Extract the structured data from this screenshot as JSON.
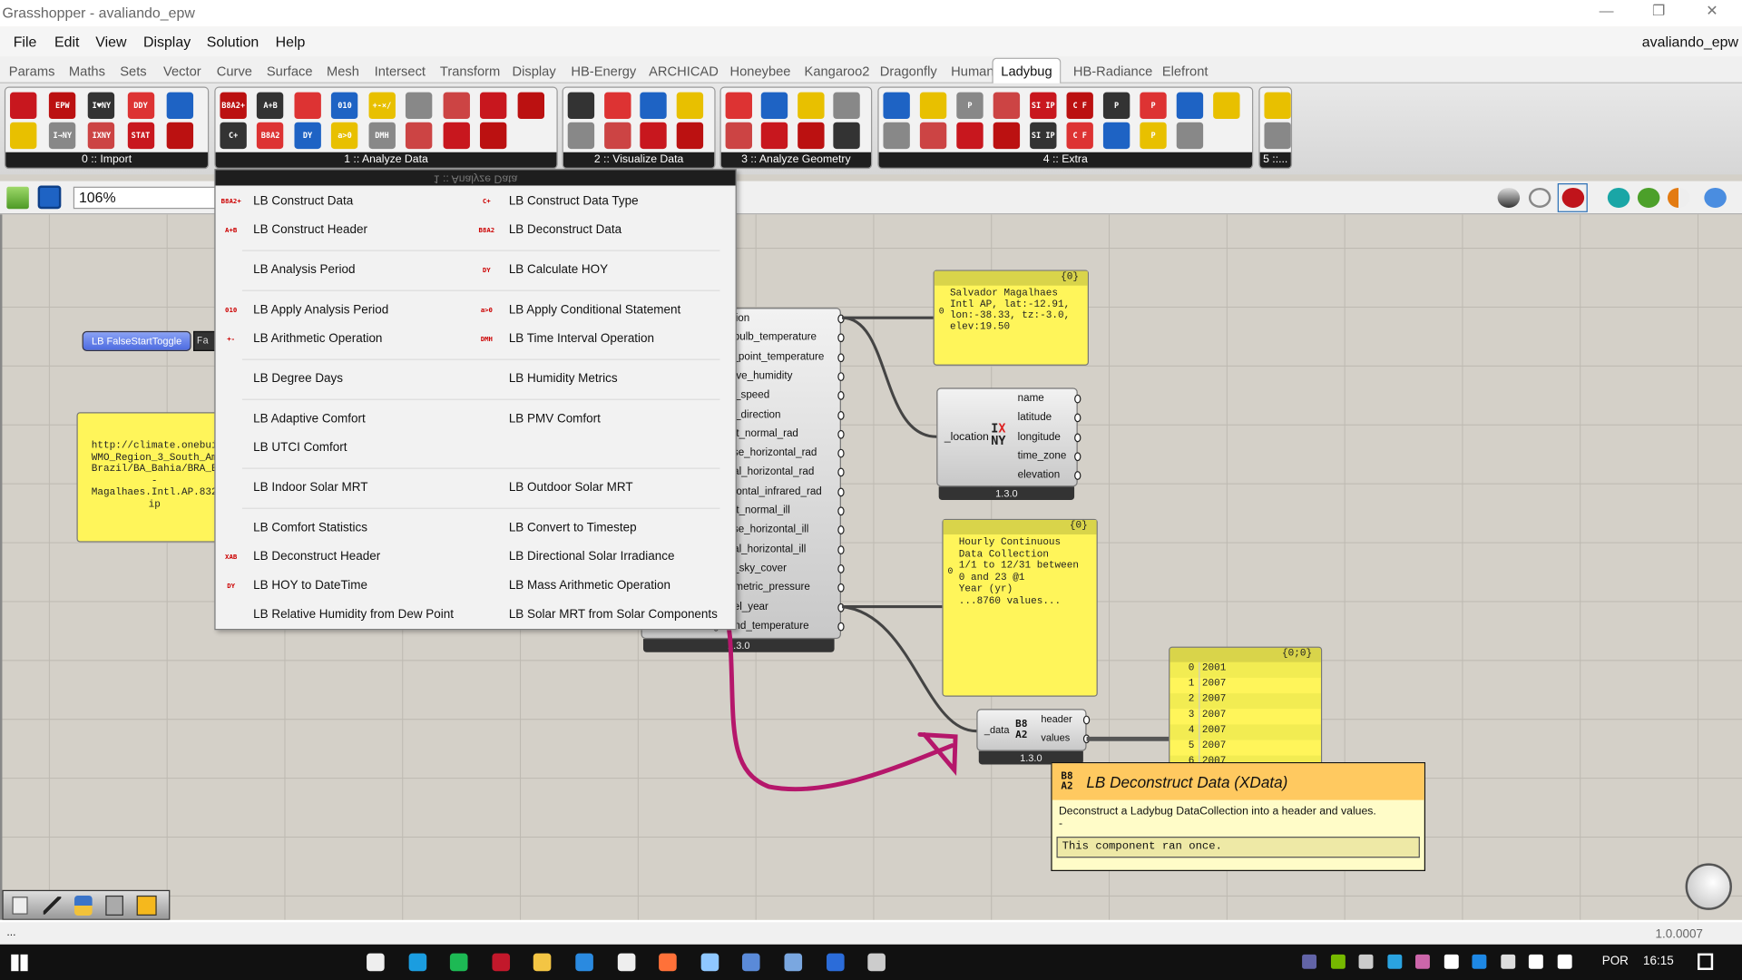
{
  "window": {
    "title": "Grasshopper - avaliando_epw",
    "document": "avaliando_epw",
    "minimize": "—",
    "restore": "❐",
    "close": "✕"
  },
  "menubar": [
    "File",
    "Edit",
    "View",
    "Display",
    "Solution",
    "Help"
  ],
  "tabs": [
    "Params",
    "Maths",
    "Sets",
    "Vector",
    "Curve",
    "Surface",
    "Mesh",
    "Intersect",
    "Transform",
    "Display",
    "HB-Energy",
    "ARCHICAD",
    "Honeybee",
    "Kangaroo2",
    "Dragonfly",
    "Human",
    "Ladybug",
    "HB-Radiance",
    "Elefront"
  ],
  "active_tab": "Ladybug",
  "ribbon_groups": [
    {
      "label": "0 :: Import",
      "icons": [
        "location-icon",
        "EPW",
        "I♥NY",
        "DDY",
        "sunpath-icon",
        "search-icon",
        "I→NY",
        "IXNY",
        "STAT",
        "terrain-icon"
      ]
    },
    {
      "label": "1 :: Analyze Data",
      "icons": [
        "B8A2+",
        "A+B",
        "period",
        "010",
        "+-×/",
        "thermo",
        "comfort",
        "utci",
        "mrt",
        "C+",
        "B8A2",
        "DY",
        "a>0",
        "DMH",
        "humid",
        "pmv",
        "mrt2"
      ]
    },
    {
      "label": "2 :: Visualize Data",
      "icons": [
        "chart",
        "chart2",
        "sun",
        "sun2",
        "bars",
        "area",
        "wind",
        "radial"
      ]
    },
    {
      "label": "3 :: Analyze Geometry",
      "icons": [
        "sun",
        "rose",
        "person",
        "shade",
        "sun3",
        "eye",
        "rad",
        "sun4"
      ]
    },
    {
      "label": "4 :: Extra",
      "icons": [
        "legend",
        "dots",
        "P",
        "camera",
        "SI IP",
        "C F",
        "P",
        "P",
        "folder",
        "target",
        "toggle",
        "image",
        "colors",
        "capture",
        "SI IP",
        "C F",
        "drop",
        "P",
        "folder2"
      ]
    },
    {
      "label": "5 ::...",
      "icons": [
        "record",
        "record2"
      ]
    }
  ],
  "canvas_toolbar": {
    "zoom": "106%",
    "open_icon": "open-folder-icon",
    "save_icon": "save-icon"
  },
  "menu": {
    "header": "1 :: Analyze Data",
    "items": [
      [
        "LB Construct Data",
        "LB Construct Data Type"
      ],
      [
        "LB Construct Header",
        "LB Deconstruct Data"
      ],
      [
        "LB Analysis Period",
        "LB Calculate HOY"
      ],
      [
        "LB Apply Analysis Period",
        "LB Apply Conditional Statement"
      ],
      [
        "LB Arithmetic Operation",
        "LB Time Interval Operation"
      ],
      [
        "LB Degree Days",
        "LB Humidity Metrics"
      ],
      [
        "LB Adaptive Comfort",
        "LB PMV Comfort"
      ],
      [
        "LB UTCI Comfort",
        ""
      ],
      [
        "LB Indoor Solar MRT",
        "LB Outdoor Solar MRT"
      ],
      [
        "LB Comfort Statistics",
        "LB Convert to Timestep"
      ],
      [
        "LB Deconstruct Header",
        "LB Directional Solar Irradiance"
      ],
      [
        "LB HOY to DateTime",
        "LB Mass Arithmetic Operation"
      ],
      [
        "LB Relative Humidity from Dew Point",
        "LB Solar MRT from Solar Components"
      ]
    ],
    "icons": [
      [
        "B8A2+",
        "C+"
      ],
      [
        "A+B",
        "B8A2"
      ],
      [
        "period",
        "DY"
      ],
      [
        "010",
        "a>0"
      ],
      [
        "+-",
        "DMH"
      ],
      [
        "deg",
        "hum"
      ],
      [
        "adp",
        "pmv"
      ],
      [
        "utci",
        ""
      ],
      [
        "mrt",
        "mrt"
      ],
      [
        "stat",
        "ts"
      ],
      [
        "XAB",
        "dir"
      ],
      [
        "DY",
        "mass"
      ],
      [
        "rh",
        "mrt"
      ]
    ]
  },
  "nodes": {
    "toggle": {
      "label": "LB FalseStartToggle",
      "value": "Fa"
    },
    "url_panel": {
      "lines": [
        "http://climate.onebui",
        "WMO_Region_3_South_Am",
        "Brazil/BA_Bahia/BRA_B",
        "-",
        "Magalhaes.Intl.AP.832",
        "ip"
      ]
    },
    "epw": {
      "outputs": [
        "location",
        "dry_bulb_temperature",
        "dew_point_temperature",
        "relative_humidity",
        "wind_speed",
        "wind_direction",
        "direct_normal_rad",
        "diffuse_horizontal_rad",
        "global_horizontal_rad",
        "horizontal_infrared_rad",
        "direct_normal_ill",
        "diffuse_horizontal_ill",
        "global_horizontal_ill",
        "total_sky_cover",
        "barometric_pressure",
        "model_year",
        "ground_temperature"
      ],
      "version": "1.3.0"
    },
    "location_panel": {
      "path": "{0}",
      "index": "0",
      "lines": [
        "Salvador Magalhaes",
        "Intl AP, lat:-12.91,",
        "lon:-38.33, tz:-3.0,",
        "elev:19.50"
      ]
    },
    "deconstruct_location": {
      "input": "_location",
      "outputs": [
        "name",
        "latitude",
        "longitude",
        "time_zone",
        "elevation"
      ],
      "version": "1.3.0"
    },
    "data_panel": {
      "path": "{0}",
      "index": "0",
      "lines": [
        "Hourly Continuous",
        "Data Collection",
        "1/1 to 12/31 between",
        "0 and 23 @1",
        "Year (yr)",
        "...8760 values..."
      ]
    },
    "deconstruct_data": {
      "input": "_data",
      "outputs": [
        "header",
        "values"
      ],
      "version": "1.3.0"
    },
    "values_panel": {
      "path": "{0;0}",
      "rows": [
        [
          "0",
          "2001"
        ],
        [
          "1",
          "2007"
        ],
        [
          "2",
          "2007"
        ],
        [
          "3",
          "2007"
        ],
        [
          "4",
          "2007"
        ],
        [
          "5",
          "2007"
        ],
        [
          "6",
          "2007"
        ]
      ]
    }
  },
  "tooltip": {
    "title": "LB Deconstruct Data (XData)",
    "description": "Deconstruct a Ladybug DataCollection into a header and values.",
    "dash": "-",
    "status": "This component ran once."
  },
  "statusbar": {
    "left": "...",
    "version": "1.0.0007"
  },
  "taskbar": {
    "apps": [
      "store",
      "edge",
      "spotify",
      "mendeley",
      "explorer",
      "vscode",
      "pycharm",
      "firefox",
      "slack",
      "revit",
      "r-app",
      "word",
      "grasshopper"
    ],
    "lang": "POR",
    "time": "16:15"
  },
  "annotation_color": "#b5176b"
}
